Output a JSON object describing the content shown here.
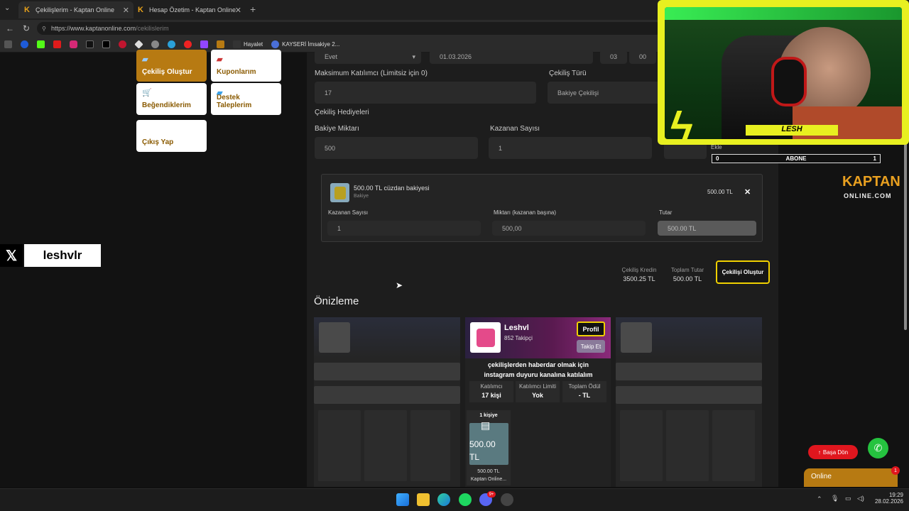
{
  "browser": {
    "tabs": [
      {
        "label": "Çekilişlerim - Kaptan Online",
        "icon": "K"
      },
      {
        "label": "Hesap Özetim - Kaptan Online",
        "icon": "K"
      }
    ],
    "url_host": "https://www.kaptanonline.com",
    "url_path": "/cekilislerim",
    "bookmarks": [
      {
        "name": "Hayalet"
      },
      {
        "name": "KAYSERİ İmsakiye 2..."
      }
    ]
  },
  "sidebar": {
    "items": [
      {
        "label": "Çekiliş Oluştur"
      },
      {
        "label": "Kuponlarım"
      },
      {
        "label": "Beğendiklerim"
      },
      {
        "label": "Destek Taleplerim"
      },
      {
        "label": "Çıkış Yap"
      }
    ]
  },
  "form": {
    "top_select": "Evet",
    "top_date": "01.03.2026",
    "top_hour": "03",
    "top_minute": "00",
    "max_participants_label": "Maksimum Katılımcı (Limitsiz için 0)",
    "max_participants_value": "17",
    "type_label": "Çekiliş Türü",
    "type_value": "Bakiye Çekilişi",
    "prizes_heading": "Çekiliş Hediyeleri",
    "balance_label": "Bakiye Miktarı",
    "balance_value": "500",
    "winners_label": "Kazanan Sayısı",
    "winners_value": "1",
    "add_label": "Ekle"
  },
  "prize": {
    "title": "500.00 TL cüzdan bakiyesi",
    "subtitle": "Bakiye",
    "amount": "500.00 TL",
    "close": "✕",
    "winners_label": "Kazanan Sayısı",
    "winners_value": "1",
    "per_winner_label": "Miktarı (kazanan başına)",
    "per_winner_value": "500,00",
    "total_label": "Tutar",
    "total_value": "500.00 TL"
  },
  "summary": {
    "credit_label": "Çekiliş Kredin",
    "credit_value": "3500.25 TL",
    "total_label": "Toplam Tutar",
    "total_value": "500.00 TL",
    "create_button": "Çekilişi Oluştur"
  },
  "preview": {
    "heading": "Önizleme",
    "user": "Leshvl",
    "followers": "852 Takipçi",
    "profile_button": "Profil",
    "follow_button": "Takip Et",
    "description": "çekilişlerden haberdar olmak için instagram duyuru kanalına katılalım",
    "stats": [
      {
        "label": "Katılımcı",
        "value": "17 kişi"
      },
      {
        "label": "Katılımcı Limiti",
        "value": "Yok"
      },
      {
        "label": "Toplam Ödül",
        "value": "- TL"
      }
    ],
    "prize_badge": "1 kişiye",
    "prize_amount": "500.00 TL",
    "prize_caption_1": "500.00 TL",
    "prize_caption_2": "Kaptan Online..."
  },
  "overlay": {
    "streamer_name": "LESH",
    "sub_left": "0",
    "sub_label": "ABONE",
    "sub_right": "1",
    "logo_main": "KAPTAN",
    "logo_sub": "ONLINE.COM",
    "x_handle": "leshvlr"
  },
  "floating": {
    "back_to_top": "Başa Dön",
    "chat_label": "Online",
    "chat_badge": "1"
  },
  "taskbar": {
    "time": "19:29",
    "date": "28.02.2026",
    "discord_badge": "9+"
  },
  "colors": {
    "accent_gold": "#b77a12",
    "highlight_yellow": "#f0d000",
    "overlay_yellow": "#e8f020",
    "danger_red": "#e0161e"
  }
}
